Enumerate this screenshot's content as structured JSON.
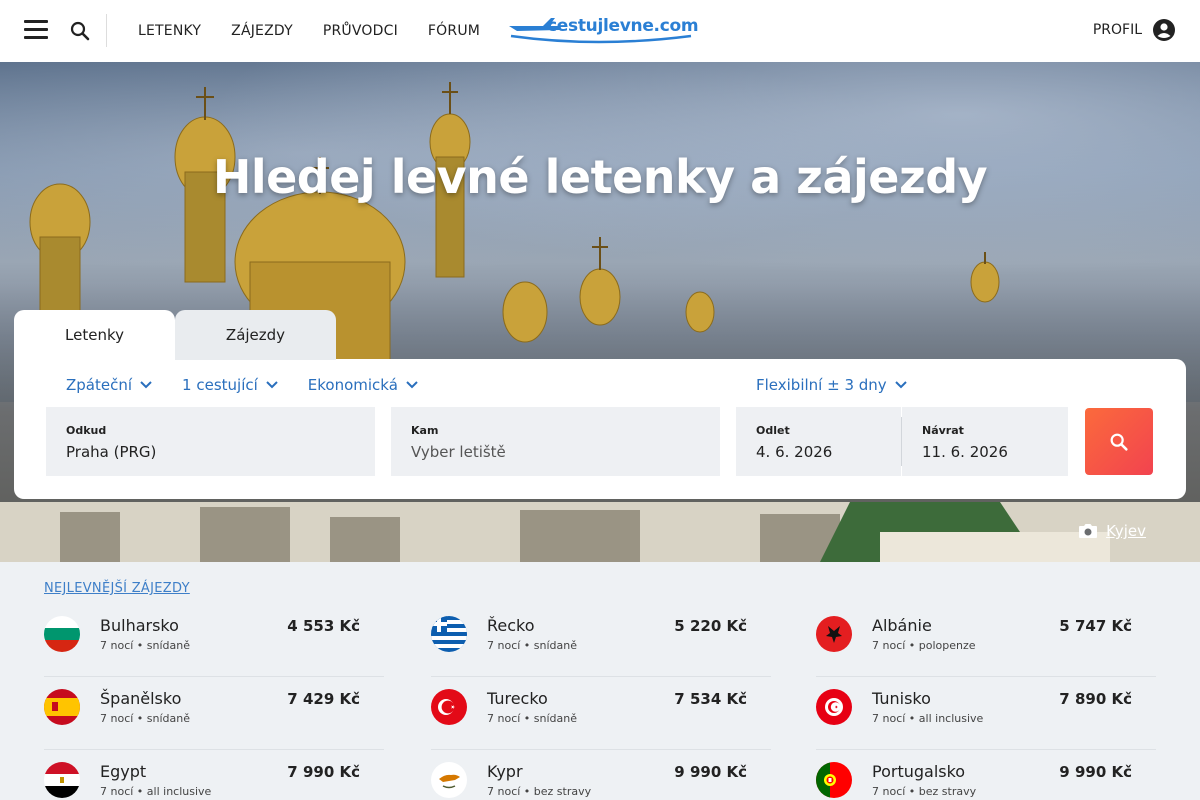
{
  "header": {
    "nav": [
      "LETENKY",
      "ZÁJEZDY",
      "PRŮVODCI",
      "FÓRUM"
    ],
    "logo_text": "cestujlevne.com",
    "profile_label": "PROFIL"
  },
  "hero": {
    "title": "Hledej levné letenky a zájezdy",
    "photo_credit": "Kyjev"
  },
  "search": {
    "tabs": [
      "Letenky",
      "Zájezdy"
    ],
    "options": [
      "Zpáteční",
      "1 cestující",
      "Ekonomická"
    ],
    "flexibility": "Flexibilní ± 3 dny",
    "from": {
      "label": "Odkud",
      "value": "Praha (PRG)"
    },
    "to": {
      "label": "Kam",
      "placeholder": "Vyber letiště"
    },
    "departure": {
      "label": "Odlet",
      "value": "4. 6. 2026"
    },
    "return": {
      "label": "Návrat",
      "value": "11. 6. 2026"
    }
  },
  "deals": {
    "title": "NEJLEVNĚJŠÍ ZÁJEZDY",
    "items": [
      {
        "country": "Bulharsko",
        "meta": "7 nocí • snídaně",
        "price": "4 553 Kč",
        "flag": "bulgaria"
      },
      {
        "country": "Řecko",
        "meta": "7 nocí • snídaně",
        "price": "5 220 Kč",
        "flag": "greece"
      },
      {
        "country": "Albánie",
        "meta": "7 nocí • polopenze",
        "price": "5 747 Kč",
        "flag": "albania"
      },
      {
        "country": "Španělsko",
        "meta": "7 nocí • snídaně",
        "price": "7 429 Kč",
        "flag": "spain"
      },
      {
        "country": "Turecko",
        "meta": "7 nocí • snídaně",
        "price": "7 534 Kč",
        "flag": "turkey"
      },
      {
        "country": "Tunisko",
        "meta": "7 nocí • all inclusive",
        "price": "7 890 Kč",
        "flag": "tunisia"
      },
      {
        "country": "Egypt",
        "meta": "7 nocí • all inclusive",
        "price": "7 990 Kč",
        "flag": "egypt"
      },
      {
        "country": "Kypr",
        "meta": "7 nocí • bez stravy",
        "price": "9 990 Kč",
        "flag": "cyprus"
      },
      {
        "country": "Portugalsko",
        "meta": "7 nocí • bez stravy",
        "price": "9 990 Kč",
        "flag": "portugal"
      }
    ]
  },
  "colors": {
    "accent": "#2a6fbd",
    "search_button": "#f2434f",
    "link": "#3e7fc8"
  }
}
